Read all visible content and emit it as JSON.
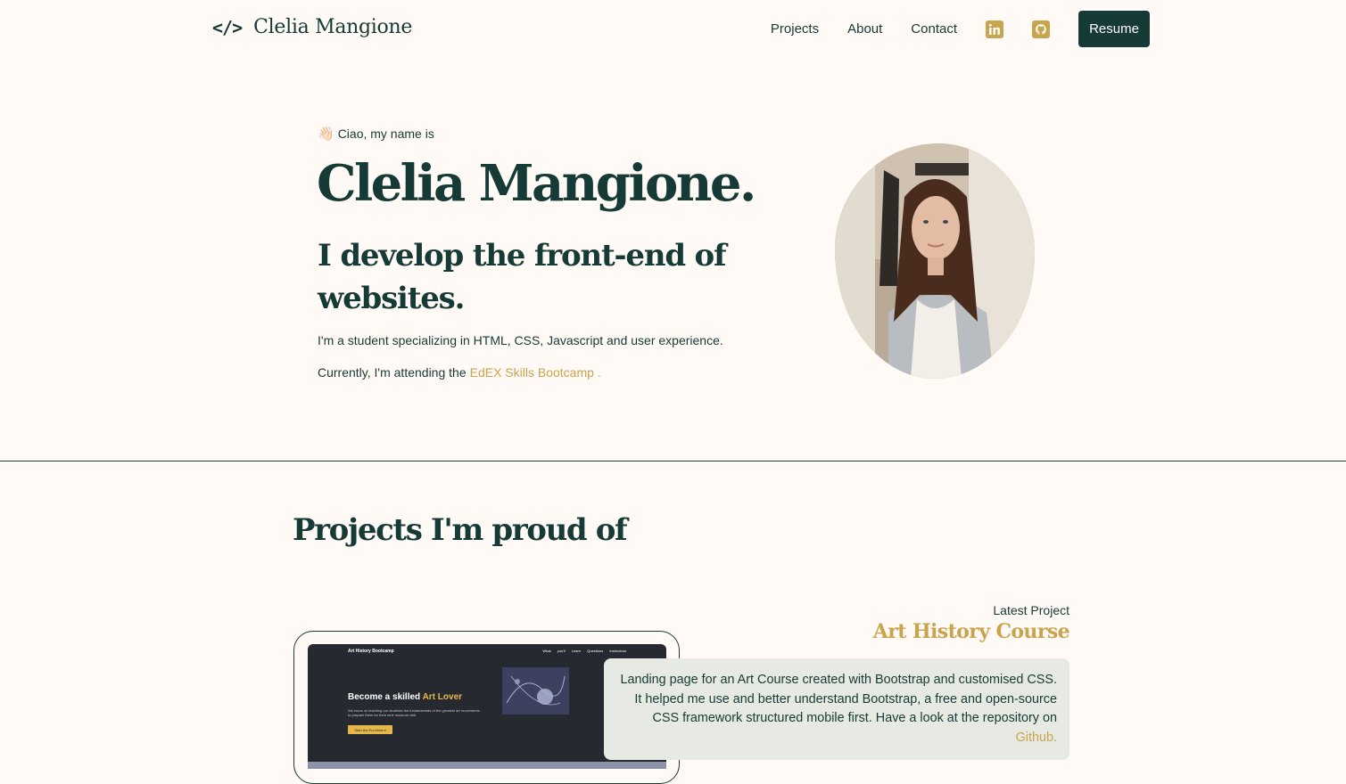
{
  "nav": {
    "logo_icon": "</>",
    "logo_text": "Clelia Mangione",
    "links": [
      "Projects",
      "About",
      "Contact"
    ],
    "social_icons": [
      "linkedin-icon",
      "github-icon"
    ],
    "resume_label": "Resume"
  },
  "hero": {
    "greeting_emoji": "👋🏻",
    "greeting": "Ciao, my name is",
    "name": "Clelia Mangione.",
    "tagline": "I develop the front-end of websites.",
    "description": "I'm a student specializing in HTML, CSS, Javascript and user experience.",
    "current_prefix": "Currently, I'm attending the",
    "current_link": "EdEX Skills Bootcamp",
    "current_suffix": "."
  },
  "projects": {
    "title": "Projects I'm proud of",
    "latest_label": "Latest Project",
    "project_name": "Art History Course",
    "description": "Landing page for an Art Course created with Bootstrap and customised CSS. It helped me use and better understand Bootstrap, a free and open-source CSS framework structured mobile first. Have a look at the repository on",
    "repo_link": "Github",
    "desc_suffix": ".",
    "preview": {
      "brand": "Art History Bootcamp",
      "nav": "What you'll Learn Questions Instructors",
      "headline_prefix": "Become a skilled",
      "headline_accent": "Art Lover",
      "sub": "We focus on teaching our students the fundamentals of the greatest art movements to prepare them for their next museum visit.",
      "button": "Start the Enrollment"
    }
  },
  "colors": {
    "background": "#fffaf5",
    "primary": "#163a36",
    "accent": "#c9a44f",
    "card": "#e6eae2"
  }
}
